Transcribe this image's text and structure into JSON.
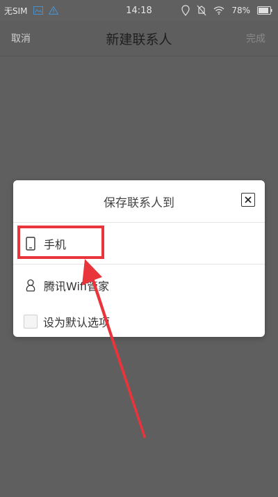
{
  "status_bar": {
    "carrier": "无SIM",
    "time": "14:18",
    "battery": "78%",
    "icons_left": [
      "image-icon",
      "warning-icon"
    ],
    "icons_right": [
      "location-icon",
      "mute-icon",
      "wifi-icon",
      "battery-icon"
    ]
  },
  "nav": {
    "cancel_label": "取消",
    "title": "新建联系人",
    "done_label": "完成"
  },
  "dialog": {
    "title": "保存联系人到",
    "options": [
      {
        "label": "手机",
        "icon": "phone-icon"
      },
      {
        "label": "腾讯Wifi管家",
        "icon": "tencent-icon"
      }
    ],
    "checkbox_label": "设为默认选项",
    "checkbox_checked": false
  },
  "annotation": {
    "highlight_color": "#e8343a"
  }
}
